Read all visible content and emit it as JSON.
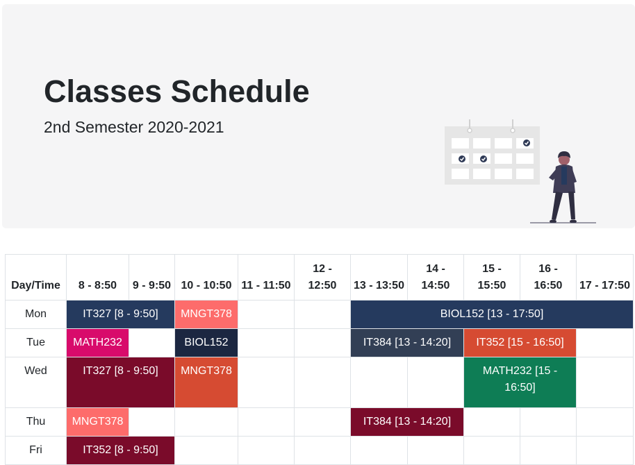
{
  "header": {
    "title": "Classes Schedule",
    "subtitle": "2nd Semester 2020-2021"
  },
  "colors": {
    "hero_bg": "#f5f5f6",
    "navy": "#253a5e",
    "salmon": "#fd6c6b",
    "magenta": "#d80b6b",
    "dark_navy": "#1c2741",
    "slate": "#323f55",
    "red_orange": "#d64b32",
    "maroon": "#7a0b2a",
    "green": "#0e7d55"
  },
  "table": {
    "corner_label": "Day/Time",
    "times": [
      "8 - 8:50",
      "9 - 9:50",
      "10 - 10:50",
      "11 - 11:50",
      "12 - 12:50",
      "13 - 13:50",
      "14 - 14:50",
      "15 - 15:50",
      "16 - 16:50",
      "17 - 17:50"
    ],
    "rows": [
      {
        "day": "Mon",
        "cells": [
          {
            "text": "IT327 [8 - 9:50]",
            "span": 2,
            "color": "#253a5e"
          },
          {
            "text": "MNGT378",
            "span": 1,
            "color": "#fd6c6b"
          },
          {
            "text": "",
            "span": 1
          },
          {
            "text": "",
            "span": 1
          },
          {
            "text": "BIOL152 [13 - 17:50]",
            "span": 5,
            "color": "#253a5e"
          }
        ]
      },
      {
        "day": "Tue",
        "cells": [
          {
            "text": "MATH232",
            "span": 1,
            "color": "#d80b6b"
          },
          {
            "text": "",
            "span": 1
          },
          {
            "text": "BIOL152",
            "span": 1,
            "color": "#1c2741"
          },
          {
            "text": "",
            "span": 1
          },
          {
            "text": "",
            "span": 1
          },
          {
            "text": "IT384 [13 - 14:20]",
            "span": 2,
            "color": "#323f55"
          },
          {
            "text": "IT352 [15 - 16:50]",
            "span": 2,
            "color": "#d64b32"
          },
          {
            "text": "",
            "span": 1
          }
        ]
      },
      {
        "day": "Wed",
        "tall": true,
        "cells": [
          {
            "text": "IT327 [8 - 9:50]",
            "span": 2,
            "color": "#7a0b2a"
          },
          {
            "text": "MNGT378",
            "span": 1,
            "color": "#d64b32"
          },
          {
            "text": "",
            "span": 1
          },
          {
            "text": "",
            "span": 1
          },
          {
            "text": "",
            "span": 1
          },
          {
            "text": "",
            "span": 1
          },
          {
            "text": "MATH232 [15 - 16:50]",
            "span": 2,
            "color": "#0e7d55"
          },
          {
            "text": "",
            "span": 1
          }
        ]
      },
      {
        "day": "Thu",
        "cells": [
          {
            "text": "MNGT378",
            "span": 1,
            "color": "#fd6c6b"
          },
          {
            "text": "",
            "span": 1
          },
          {
            "text": "",
            "span": 1
          },
          {
            "text": "",
            "span": 1
          },
          {
            "text": "",
            "span": 1
          },
          {
            "text": "IT384 [13 - 14:20]",
            "span": 2,
            "color": "#7a0b2a"
          },
          {
            "text": "",
            "span": 1
          },
          {
            "text": "",
            "span": 1
          },
          {
            "text": "",
            "span": 1
          }
        ]
      },
      {
        "day": "Fri",
        "cells": [
          {
            "text": "IT352 [8 - 9:50]",
            "span": 2,
            "color": "#7a0b2a"
          },
          {
            "text": "",
            "span": 1
          },
          {
            "text": "",
            "span": 1
          },
          {
            "text": "",
            "span": 1
          },
          {
            "text": "",
            "span": 1
          },
          {
            "text": "",
            "span": 1
          },
          {
            "text": "",
            "span": 1
          },
          {
            "text": "",
            "span": 1
          },
          {
            "text": "",
            "span": 1
          }
        ]
      }
    ]
  }
}
